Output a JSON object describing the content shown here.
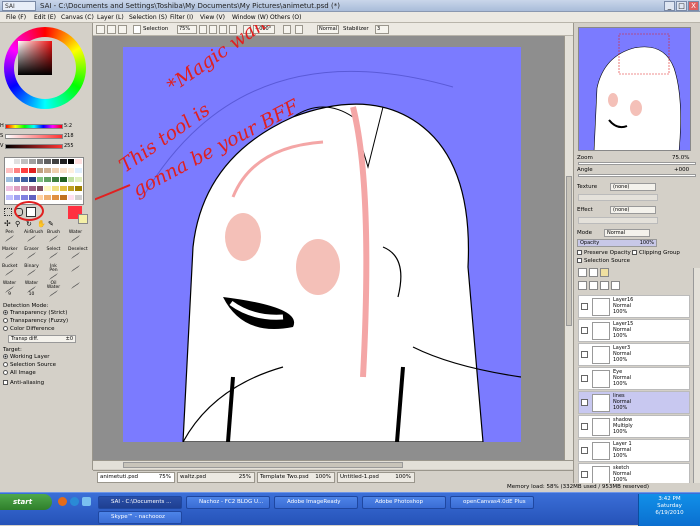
{
  "window": {
    "app_name": "SAI",
    "title": "SAI - C:\\Documents and Settings\\Toshiba\\My Documents\\My Pictures\\animetut.psd (*)",
    "buttons": [
      "_",
      "□",
      "X"
    ]
  },
  "menu": [
    "File (F)",
    "Edit (E)",
    "Canvas (C)",
    "Layer (L)",
    "Selection (S)",
    "Filter (I)",
    "View (V)",
    "Window (W)",
    "Others (O)"
  ],
  "toolbar": {
    "selection_label": "Selection",
    "zoom": "75%",
    "angle": "+000°",
    "blend_mode": "Normal",
    "stabilizer_label": "Stabilizer",
    "stabilizer_value": "3"
  },
  "color_panel": {
    "h_label": "H",
    "h_value": "5:2",
    "s_label": "S",
    "s_value": "218",
    "v_label": "V",
    "v_value": "255",
    "primary_color": "#ff3040",
    "secondary_color": "#f4f0a8",
    "swatches": [
      "#ffffff",
      "#e0e0e0",
      "#c0c0c0",
      "#a0a0a0",
      "#808080",
      "#606060",
      "#404040",
      "#202020",
      "#000000",
      "#ffe0e0",
      "#ffc0c0",
      "#ff8080",
      "#ff4040",
      "#e02020",
      "#c0a080",
      "#d0b090",
      "#f0d0b0",
      "#f8e0c8",
      "#fff0e0",
      "#e0f0ff",
      "#a0c0e0",
      "#6080c0",
      "#4060a0",
      "#204080",
      "#80c080",
      "#60a060",
      "#408040",
      "#206020",
      "#c0e0a0",
      "#e0f0c0",
      "#f0c0e0",
      "#e0a0c0",
      "#c080a0",
      "#a06080",
      "#805060",
      "#fff8c0",
      "#f0e080",
      "#e0c040",
      "#c0a020",
      "#a08000",
      "#c0c0ff",
      "#a0a0f0",
      "#8080e0",
      "#6060c0",
      "#ffd0a0",
      "#f0b070",
      "#e09040",
      "#c07020",
      "#ffe0f0",
      "#d0d0d0"
    ]
  },
  "tools": {
    "brushes": [
      {
        "name": "Pen",
        "size": ""
      },
      {
        "name": "AirBrush",
        "size": ""
      },
      {
        "name": "Brush",
        "size": ""
      },
      {
        "name": "Water",
        "size": ""
      },
      {
        "name": "Marker",
        "size": ""
      },
      {
        "name": "Eraser",
        "size": ""
      },
      {
        "name": "Select",
        "size": ""
      },
      {
        "name": "Deselect",
        "size": ""
      },
      {
        "name": "Bucket",
        "size": ""
      },
      {
        "name": "Binary",
        "size": ""
      },
      {
        "name": "Ink Pen",
        "size": ""
      },
      {
        "name": "",
        "size": ""
      },
      {
        "name": "Water",
        "size": "9"
      },
      {
        "name": "Water",
        "size": "10"
      },
      {
        "name": "Oil Water",
        "size": ""
      },
      {
        "name": "",
        "size": ""
      }
    ]
  },
  "detection": {
    "label": "Detection Mode:",
    "options": [
      "Transparency (Strict)",
      "Transparency (Fuzzy)",
      "Color Difference"
    ],
    "selected": 0,
    "transp_label": "Transp diff.",
    "transp_value": "±0",
    "target_label": "Target:",
    "targets": [
      "Working Layer",
      "Selection Source",
      "All Image"
    ],
    "target_selected": 0,
    "antialias_label": "Anti-aliasing"
  },
  "annotation": {
    "line1": "*Magic wand*",
    "line2": "This tool is",
    "line3": "gonna be your BFF"
  },
  "navigator": {
    "zoom_label": "Zoom",
    "zoom_value": "75.0%",
    "angle_label": "Angle",
    "angle_value": "+000"
  },
  "layer_props": {
    "texture_label": "Texture",
    "texture_value": "(none)",
    "effect_label": "Effect",
    "effect_value": "(none)",
    "mode_label": "Mode",
    "mode_value": "Normal",
    "opacity_label": "Opacity",
    "opacity_value": "100%",
    "preserve_opacity": "Preserve Opacity",
    "clipping_group": "Clipping Group",
    "selection_source": "Selection Source"
  },
  "layers": [
    {
      "name": "Layer16",
      "mode": "Normal",
      "opacity": "100%"
    },
    {
      "name": "Layer15",
      "mode": "Normal",
      "opacity": "100%"
    },
    {
      "name": "Layer3",
      "mode": "Normal",
      "opacity": "100%"
    },
    {
      "name": "Eye",
      "mode": "Normal",
      "opacity": "100%"
    },
    {
      "name": "lines",
      "mode": "Normal",
      "opacity": "100%"
    },
    {
      "name": "shadow",
      "mode": "Multiply",
      "opacity": "100%"
    },
    {
      "name": "Layer 1",
      "mode": "Normal",
      "opacity": "100%"
    },
    {
      "name": "sketch",
      "mode": "Normal",
      "opacity": "100%"
    }
  ],
  "doc_tabs": [
    {
      "name": "animetuti.psd",
      "pct": "75%"
    },
    {
      "name": "waltz.psd",
      "pct": "25%"
    },
    {
      "name": "Template Two.psd",
      "pct": "100%"
    },
    {
      "name": "Untitled-1.psd",
      "pct": "100%"
    }
  ],
  "status": "Memory load: 58% (332MB used / 953MB reserved)",
  "taskbar": {
    "start": "start",
    "tasks": [
      "SAI - C:\\Documents ...",
      "Nachoz - FC2 BLOG U...",
      "Adobe ImageReady",
      "Adobe Photoshop",
      "openCanvas4.0dE Plus"
    ],
    "tasks_row2": [
      "Skype™ - nachoooz"
    ],
    "time": "3:42 PM",
    "day": "Saturday",
    "date": "6/19/2010"
  }
}
